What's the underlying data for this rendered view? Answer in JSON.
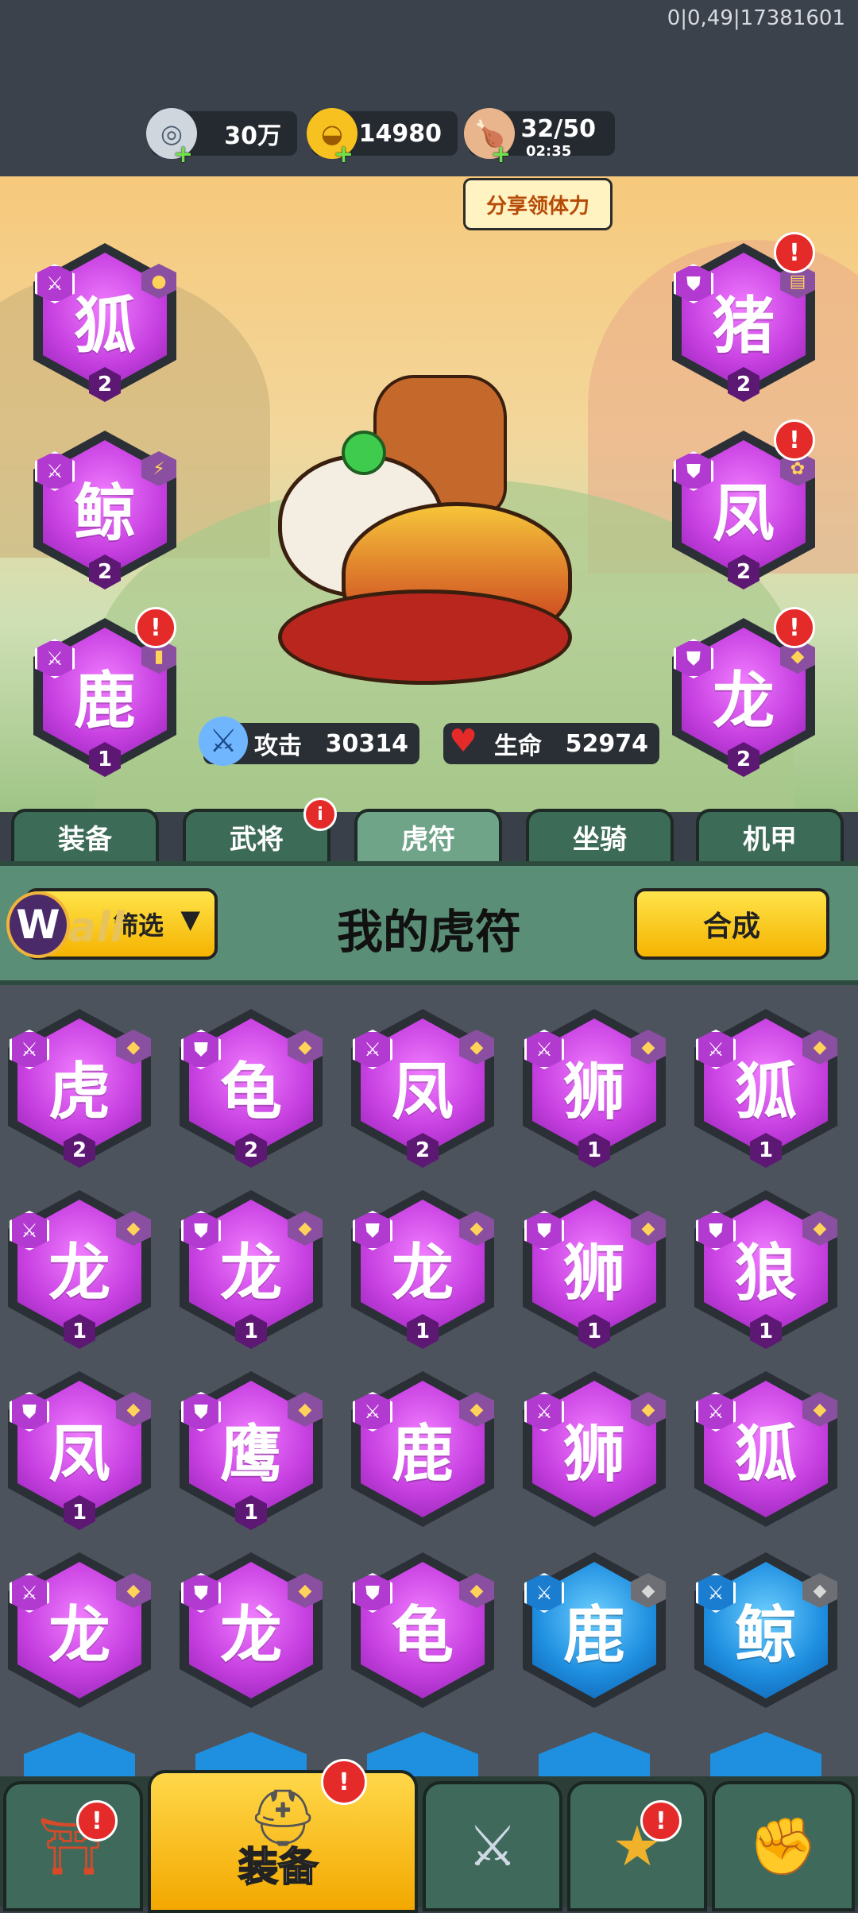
{
  "debug_text": "0|0,49|17381601",
  "resources": [
    {
      "icon": "coin-icon",
      "value": "30万"
    },
    {
      "icon": "gold-ingot-icon",
      "value": "14980"
    },
    {
      "icon": "drumstick-icon",
      "value": "32/50",
      "timer": "02:35"
    }
  ],
  "share_button": "分享领体力",
  "equipped_left": [
    {
      "glyph": "狐",
      "level": "2",
      "alert": false
    },
    {
      "glyph": "鲸",
      "level": "2",
      "alert": false
    },
    {
      "glyph": "鹿",
      "level": "1",
      "alert": true
    }
  ],
  "equipped_right": [
    {
      "glyph": "猪",
      "level": "2",
      "alert": true
    },
    {
      "glyph": "凤",
      "level": "2",
      "alert": true
    },
    {
      "glyph": "龙",
      "level": "2",
      "alert": true
    }
  ],
  "stats": {
    "attack_label": "攻击",
    "attack_value": "30314",
    "hp_label": "生命",
    "hp_value": "52974"
  },
  "tabs": [
    "装备",
    "武将",
    "虎符",
    "坐骑",
    "机甲"
  ],
  "active_tab": "虎符",
  "filter": {
    "wall_text": "all",
    "label": "筛选"
  },
  "panel_title": "我的虎符",
  "merge_button": "合成",
  "tally_grid": [
    {
      "glyph": "虎",
      "level": "2",
      "color": "purple",
      "emblem": "sword"
    },
    {
      "glyph": "龟",
      "level": "2",
      "color": "purple",
      "emblem": "shield"
    },
    {
      "glyph": "凤",
      "level": "2",
      "color": "purple",
      "emblem": "sword"
    },
    {
      "glyph": "狮",
      "level": "1",
      "color": "purple",
      "emblem": "sword"
    },
    {
      "glyph": "狐",
      "level": "1",
      "color": "purple",
      "emblem": "sword"
    },
    {
      "glyph": "龙",
      "level": "1",
      "color": "purple",
      "emblem": "sword"
    },
    {
      "glyph": "龙",
      "level": "1",
      "color": "purple",
      "emblem": "shield"
    },
    {
      "glyph": "龙",
      "level": "1",
      "color": "purple",
      "emblem": "shield"
    },
    {
      "glyph": "狮",
      "level": "1",
      "color": "purple",
      "emblem": "shield"
    },
    {
      "glyph": "狼",
      "level": "1",
      "color": "purple",
      "emblem": "shield"
    },
    {
      "glyph": "凤",
      "level": "1",
      "color": "purple",
      "emblem": "shield"
    },
    {
      "glyph": "鹰",
      "level": "1",
      "color": "purple",
      "emblem": "shield"
    },
    {
      "glyph": "鹿",
      "level": "",
      "color": "purple",
      "emblem": "sword"
    },
    {
      "glyph": "狮",
      "level": "",
      "color": "purple",
      "emblem": "sword"
    },
    {
      "glyph": "狐",
      "level": "",
      "color": "purple",
      "emblem": "sword"
    },
    {
      "glyph": "龙",
      "level": "",
      "color": "purple",
      "emblem": "sword"
    },
    {
      "glyph": "龙",
      "level": "",
      "color": "purple",
      "emblem": "shield"
    },
    {
      "glyph": "龟",
      "level": "",
      "color": "purple",
      "emblem": "shield"
    },
    {
      "glyph": "鹿",
      "level": "",
      "color": "blue",
      "emblem": "sword"
    },
    {
      "glyph": "鲸",
      "level": "",
      "color": "blue",
      "emblem": "sword"
    }
  ],
  "bottom_nav": [
    {
      "icon": "shop-gate-icon",
      "alert": true
    },
    {
      "icon": "helmet-icon",
      "label": "装备",
      "alert": true,
      "active": true
    },
    {
      "icon": "battle-swords-icon",
      "alert": false
    },
    {
      "icon": "hero-stars-icon",
      "alert": true
    },
    {
      "icon": "upgrade-fist-icon",
      "alert": false
    }
  ],
  "colors": {
    "purple": "#c63fe0",
    "blue": "#1f8fe0",
    "accent_yellow": "#f5b300",
    "alert_red": "#e52a2a"
  }
}
